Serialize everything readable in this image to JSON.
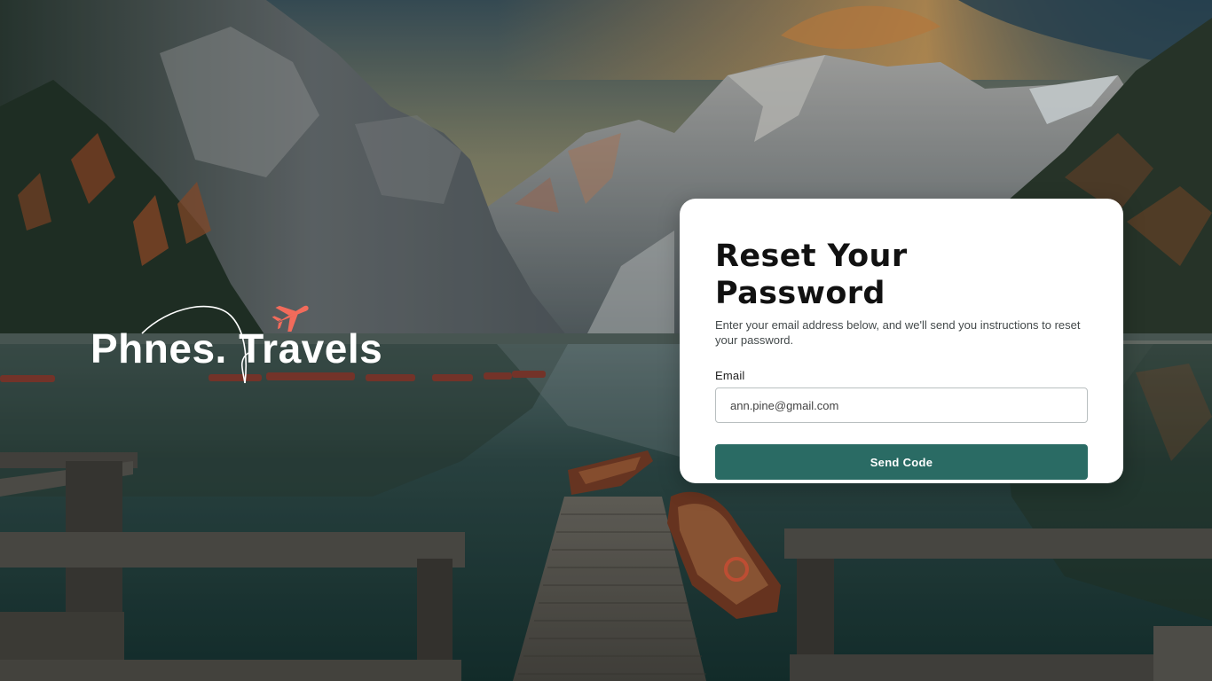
{
  "brand": {
    "name": "Phnes. Travels",
    "icon": "airplane-icon",
    "icon_color": "#f26b5b"
  },
  "reset_card": {
    "title": "Reset Your Password",
    "description": "Enter your email address below, and we'll send you instructions to reset your password.",
    "email_label": "Email",
    "email_value": "ann.pine@gmail.com",
    "submit_label": "Send Code"
  },
  "colors": {
    "accent": "#2a6b64",
    "card_background": "#ffffff"
  }
}
